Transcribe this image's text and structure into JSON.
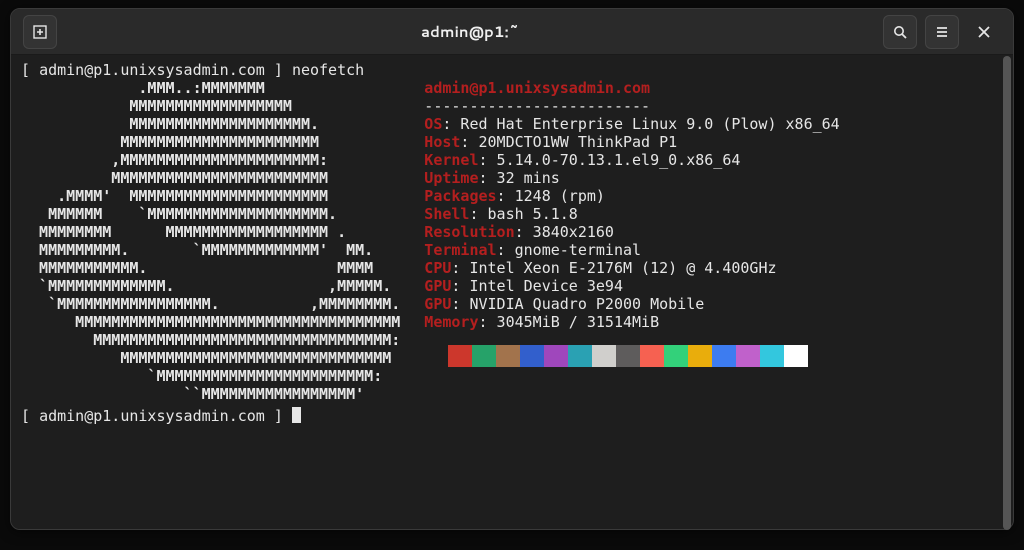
{
  "window": {
    "title": "admin@p1:~"
  },
  "prompt_user": "admin@p1.unixsysadmin.com",
  "command": "neofetch",
  "ascii_art": "             .MMM..:MMMMMMM\n            MMMMMMMMMMMMMMMMMM\n            MMMMMMMMMMMMMMMMMMMM.\n           MMMMMMMMMMMMMMMMMMMMMM\n          ,MMMMMMMMMMMMMMMMMMMMMM:\n          MMMMMMMMMMMMMMMMMMMMMMMM\n    .MMMM'  MMMMMMMMMMMMMMMMMMMMMM\n   MMMMMM    `MMMMMMMMMMMMMMMMMMMM.\n  MMMMMMMM      MMMMMMMMMMMMMMMMMM .\n  MMMMMMMMM.       `MMMMMMMMMMMMM'  MM.\n  MMMMMMMMMMM.                     MMMM\n  `MMMMMMMMMMMMM.                 ,MMMMM.\n   `MMMMMMMMMMMMMMMMM.          ,MMMMMMMM.\n      MMMMMMMMMMMMMMMMMMMMMMMMMMMMMMMMMMMM\n        MMMMMMMMMMMMMMMMMMMMMMMMMMMMMMMMM:\n           MMMMMMMMMMMMMMMMMMMMMMMMMMMMMM\n              `MMMMMMMMMMMMMMMMMMMMMMMM:\n                  ``MMMMMMMMMMMMMMMMM'",
  "neofetch": {
    "hostline": "admin@p1.unixsysadmin.com",
    "dashes": "-------------------------",
    "rows": [
      {
        "k": "OS",
        "v": "Red Hat Enterprise Linux 9.0 (Plow) x86_64"
      },
      {
        "k": "Host",
        "v": "20MDCTO1WW ThinkPad P1"
      },
      {
        "k": "Kernel",
        "v": "5.14.0-70.13.1.el9_0.x86_64"
      },
      {
        "k": "Uptime",
        "v": "32 mins"
      },
      {
        "k": "Packages",
        "v": "1248 (rpm)"
      },
      {
        "k": "Shell",
        "v": "bash 5.1.8"
      },
      {
        "k": "Resolution",
        "v": "3840x2160"
      },
      {
        "k": "Terminal",
        "v": "gnome-terminal"
      },
      {
        "k": "CPU",
        "v": "Intel Xeon E-2176M (12) @ 4.400GHz"
      },
      {
        "k": "GPU",
        "v": "Intel Device 3e94"
      },
      {
        "k": "GPU",
        "v": "NVIDIA Quadro P2000 Mobile"
      },
      {
        "k": "Memory",
        "v": "3045MiB / 31514MiB"
      }
    ],
    "swatches": [
      "#1e1e1e",
      "#cc372c",
      "#26a269",
      "#a2734c",
      "#325fcc",
      "#9f47bc",
      "#2aa1b3",
      "#d0cfcc",
      "#5e5c5c",
      "#f66151",
      "#33d17a",
      "#e9ad0c",
      "#3d7cf0",
      "#c061cb",
      "#33c7de",
      "#ffffff"
    ]
  }
}
